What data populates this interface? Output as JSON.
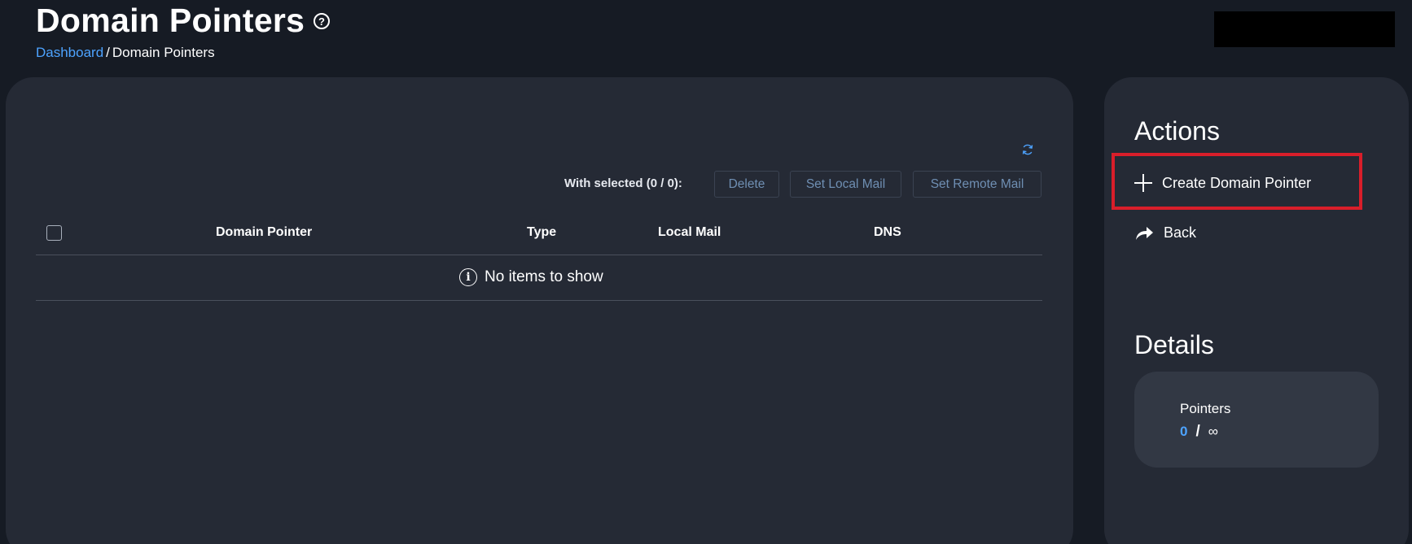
{
  "header": {
    "title": "Domain Pointers",
    "help_icon": "question-circle-icon"
  },
  "breadcrumb": {
    "home": "Dashboard",
    "separator": "/",
    "current": "Domain Pointers"
  },
  "toolbar": {
    "refresh_icon": "refresh-icon",
    "with_selected": "With selected (0 / 0):",
    "delete_label": "Delete",
    "set_local_mail_label": "Set Local Mail",
    "set_remote_mail_label": "Set Remote Mail"
  },
  "table": {
    "columns": [
      "Domain Pointer",
      "Type",
      "Local Mail",
      "DNS"
    ],
    "empty_message": "No items to show",
    "empty_icon": "info-icon"
  },
  "actions": {
    "heading": "Actions",
    "create_label": "Create Domain Pointer",
    "create_icon": "plus-icon",
    "back_label": "Back",
    "back_icon": "share-arrow-icon"
  },
  "details": {
    "heading": "Details",
    "label": "Pointers",
    "used": "0",
    "separator": "/",
    "limit": "∞"
  },
  "colors": {
    "background": "#161b24",
    "panel": "#252a35",
    "accent": "#4da3ff",
    "highlight": "#d91e2a"
  }
}
